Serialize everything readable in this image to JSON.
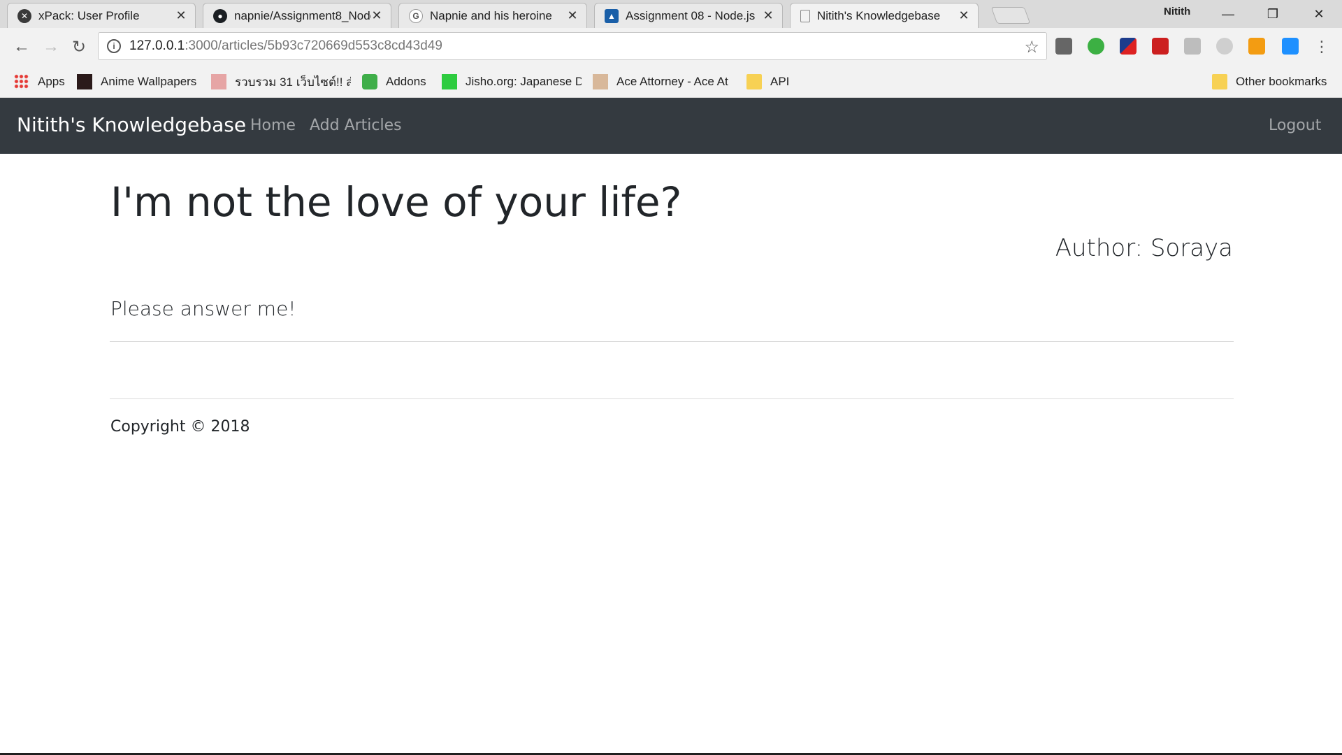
{
  "browser": {
    "tabs": [
      {
        "title": "xPack: User Profile",
        "icon": "xpack-icon",
        "active": false
      },
      {
        "title": "napnie/Assignment8_Node",
        "icon": "github-icon",
        "active": false
      },
      {
        "title": "Napnie and his heroine",
        "icon": "google-icon",
        "active": false
      },
      {
        "title": "Assignment 08 - Node.js",
        "icon": "classroom-icon",
        "active": false
      },
      {
        "title": "Nitith's Knowledgebase",
        "icon": "page-icon",
        "active": true
      }
    ],
    "profile": "Nitith",
    "url_host": "127.0.0.1",
    "url_path": ":3000/articles/5b93c720669d553c8cd43d49",
    "bookmarks": [
      {
        "label": "Apps",
        "icon": "apps-grid-icon"
      },
      {
        "label": "Anime Wallpapers",
        "icon": "anime-icon"
      },
      {
        "label": "รวบรวม 31 เว็บไซต์!! สำห",
        "icon": "thai-site-icon"
      },
      {
        "label": "Addons",
        "icon": "puzzle-icon"
      },
      {
        "label": "Jisho.org: Japanese D",
        "icon": "jisho-icon"
      },
      {
        "label": "Ace Attorney - Ace At",
        "icon": "ace-attorney-icon"
      },
      {
        "label": "API",
        "icon": "folder-icon"
      }
    ],
    "other_bookmarks": "Other bookmarks"
  },
  "navbar": {
    "brand": "Nitith's Knowledgebase",
    "links": [
      "Home",
      "Add Articles"
    ],
    "logout": "Logout"
  },
  "article": {
    "title": "I'm not the love of your life?",
    "author": "Author: Soraya",
    "body": "Please answer me!"
  },
  "footer": {
    "copyright": "Copyright © 2018"
  },
  "colors": {
    "navbar_bg": "#343a40",
    "text": "#212529"
  }
}
